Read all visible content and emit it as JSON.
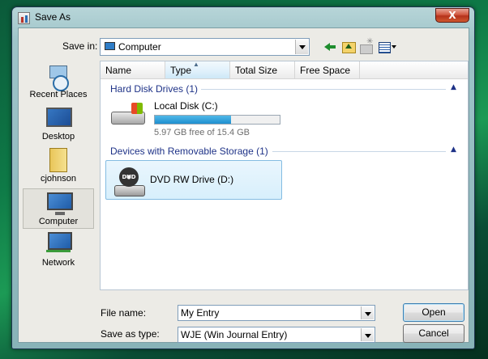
{
  "window": {
    "title": "Save As",
    "close_label": "X"
  },
  "toolbar": {
    "save_in_label": "Save in:",
    "save_in_value": "Computer",
    "icons": [
      "back-icon",
      "up-folder-icon",
      "new-folder-icon",
      "views-menu-icon"
    ]
  },
  "places": [
    {
      "label": "Recent Places",
      "icon": "recent-places-icon",
      "selected": false
    },
    {
      "label": "Desktop",
      "icon": "desktop-icon",
      "selected": false
    },
    {
      "label": "cjohnson",
      "icon": "user-folder-icon",
      "selected": false
    },
    {
      "label": "Computer",
      "icon": "computer-icon",
      "selected": true
    },
    {
      "label": "Network",
      "icon": "network-icon",
      "selected": false
    }
  ],
  "columns": [
    "Name",
    "Type",
    "Total Size",
    "Free Space"
  ],
  "sorted_column": "Type",
  "groups": {
    "hdd": {
      "title": "Hard Disk Drives (1)",
      "drive_name": "Local Disk (C:)",
      "free_text": "5.97 GB free of 15.4 GB",
      "used_fraction": 0.612
    },
    "removable": {
      "title": "Devices with Removable Storage (1)",
      "drive_name": "DVD RW Drive (D:)",
      "disc_label": "DVD"
    }
  },
  "form": {
    "file_name_label": "File name:",
    "file_name_value": "My Entry",
    "save_type_label": "Save as type:",
    "save_type_value": "WJE (Win Journal Entry)"
  },
  "buttons": {
    "open": "Open",
    "cancel": "Cancel"
  },
  "colors": {
    "group_title": "#1e3287",
    "capacity_bar": "#1f8fcf",
    "close_button": "#c43b22"
  }
}
